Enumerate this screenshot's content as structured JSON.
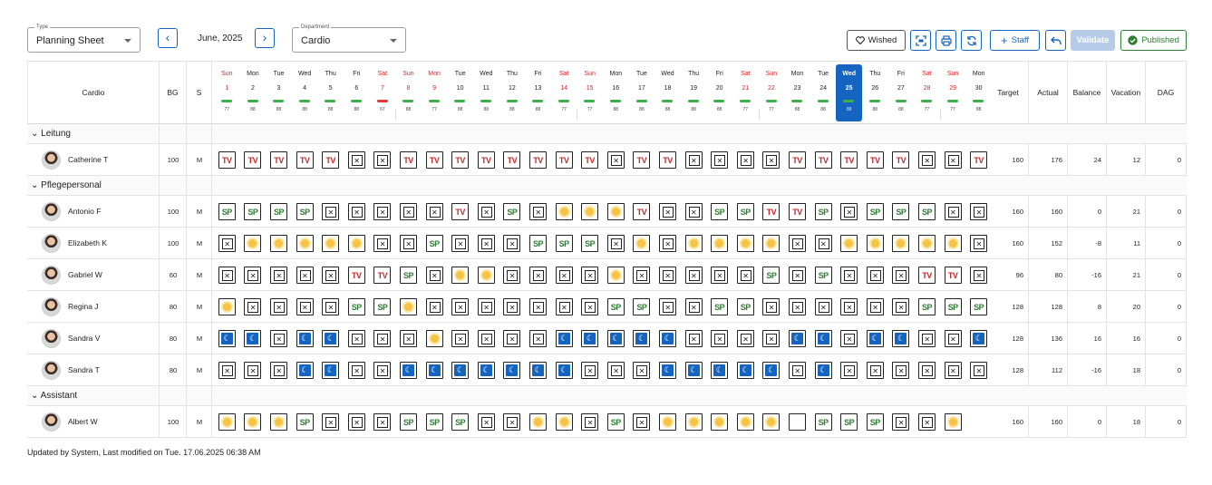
{
  "toolbar": {
    "type_label": "Type",
    "type_value": "Planning Sheet",
    "department_label": "Department",
    "department_value": "Cardio",
    "month": "June, 2025",
    "wished_label": "Wished",
    "staff_label": "Staff",
    "validate_label": "Validate",
    "published_label": "Published"
  },
  "grid": {
    "dept_header": "Cardio",
    "bg_header": "BG",
    "s_header": "S",
    "summary_headers": [
      "Target",
      "Actual",
      "Balance",
      "Vacation",
      "DAG"
    ],
    "days": [
      {
        "dn": "Sun",
        "dd": "1",
        "cnt": "77",
        "we": true,
        "red": false
      },
      {
        "dn": "Mon",
        "dd": "2",
        "cnt": "88",
        "we": false,
        "red": false
      },
      {
        "dn": "Tue",
        "dd": "3",
        "cnt": "88",
        "we": false,
        "red": false
      },
      {
        "dn": "Wed",
        "dd": "4",
        "cnt": "88",
        "we": false,
        "red": false
      },
      {
        "dn": "Thu",
        "dd": "5",
        "cnt": "88",
        "we": false,
        "red": false
      },
      {
        "dn": "Fri",
        "dd": "6",
        "cnt": "88",
        "we": false,
        "red": false
      },
      {
        "dn": "Sat",
        "dd": "7",
        "cnt": "67",
        "we": true,
        "red": true
      },
      {
        "dn": "Sun",
        "dd": "8",
        "cnt": "88",
        "we": true,
        "red": false
      },
      {
        "dn": "Mon",
        "dd": "9",
        "cnt": "77",
        "we": true,
        "red": false
      },
      {
        "dn": "Tue",
        "dd": "10",
        "cnt": "88",
        "we": false,
        "red": false
      },
      {
        "dn": "Wed",
        "dd": "11",
        "cnt": "88",
        "we": false,
        "red": false
      },
      {
        "dn": "Thu",
        "dd": "12",
        "cnt": "88",
        "we": false,
        "red": false
      },
      {
        "dn": "Fri",
        "dd": "13",
        "cnt": "88",
        "we": false,
        "red": false
      },
      {
        "dn": "Sat",
        "dd": "14",
        "cnt": "77",
        "we": true,
        "red": false
      },
      {
        "dn": "Sun",
        "dd": "15",
        "cnt": "77",
        "we": true,
        "red": false
      },
      {
        "dn": "Mon",
        "dd": "16",
        "cnt": "88",
        "we": false,
        "red": false
      },
      {
        "dn": "Tue",
        "dd": "17",
        "cnt": "88",
        "we": false,
        "red": false
      },
      {
        "dn": "Wed",
        "dd": "18",
        "cnt": "88",
        "we": false,
        "red": false
      },
      {
        "dn": "Thu",
        "dd": "19",
        "cnt": "88",
        "we": false,
        "red": false
      },
      {
        "dn": "Fri",
        "dd": "20",
        "cnt": "88",
        "we": false,
        "red": false
      },
      {
        "dn": "Sat",
        "dd": "21",
        "cnt": "77",
        "we": true,
        "red": false
      },
      {
        "dn": "Sun",
        "dd": "22",
        "cnt": "77",
        "we": true,
        "red": false
      },
      {
        "dn": "Mon",
        "dd": "23",
        "cnt": "88",
        "we": false,
        "red": false
      },
      {
        "dn": "Tue",
        "dd": "24",
        "cnt": "88",
        "we": false,
        "red": false
      },
      {
        "dn": "Wed",
        "dd": "25",
        "cnt": "88",
        "we": false,
        "red": false,
        "today": true
      },
      {
        "dn": "Thu",
        "dd": "26",
        "cnt": "88",
        "we": false,
        "red": false
      },
      {
        "dn": "Fri",
        "dd": "27",
        "cnt": "88",
        "we": false,
        "red": false
      },
      {
        "dn": "Sat",
        "dd": "28",
        "cnt": "77",
        "we": true,
        "red": false
      },
      {
        "dn": "Sun",
        "dd": "29",
        "cnt": "77",
        "we": true,
        "red": false
      },
      {
        "dn": "Mon",
        "dd": "30",
        "cnt": "88",
        "we": false,
        "red": false
      }
    ],
    "groups": [
      {
        "label": "Leitung",
        "employees": [
          {
            "name": "Catherine T",
            "bg": "100",
            "s": "M",
            "shifts": [
              "TV",
              "TV",
              "TV",
              "TV",
              "TV",
              "X",
              "X",
              "TV",
              "TV",
              "TV",
              "TV",
              "TV",
              "TV",
              "TV",
              "TV",
              "X",
              "TV",
              "TV",
              "X",
              "X",
              "X",
              "X",
              "TV",
              "TV",
              "TV",
              "TV",
              "TV",
              "X",
              "X",
              "TV"
            ],
            "target": "160",
            "actual": "176",
            "balance": "24",
            "vacation": "12",
            "dag": "0"
          }
        ]
      },
      {
        "label": "Pflegepersonal",
        "employees": [
          {
            "name": "Antonio F",
            "bg": "100",
            "s": "M",
            "shifts": [
              "SP",
              "SP",
              "SP",
              "SP",
              "X",
              "X",
              "X",
              "X",
              "X",
              "TV",
              "X",
              "SP",
              "X",
              "S",
              "S",
              "S",
              "TV",
              "X",
              "X",
              "SP",
              "SP",
              "TV",
              "TV",
              "SP",
              "X",
              "SP",
              "SP",
              "SP",
              "X",
              "X",
              "S"
            ],
            "target": "160",
            "actual": "160",
            "balance": "0",
            "vacation": "21",
            "dag": "0"
          },
          {
            "name": "Elizabeth K",
            "bg": "100",
            "s": "M",
            "shifts": [
              "X",
              "S",
              "S",
              "S",
              "S",
              "S",
              "X",
              "X",
              "SP",
              "X",
              "X",
              "X",
              "SP",
              "SP",
              "SP",
              "X",
              "S",
              "X",
              "S",
              "S",
              "S",
              "S",
              "X",
              "X",
              "S",
              "S",
              "S",
              "S",
              "S",
              "X"
            ],
            "target": "160",
            "actual": "152",
            "balance": "-8",
            "vacation": "11",
            "dag": "0"
          },
          {
            "name": "Gabriel W",
            "bg": "60",
            "s": "M",
            "shifts": [
              "X",
              "X",
              "X",
              "X",
              "X",
              "TV",
              "TV",
              "SP",
              "X",
              "S",
              "S",
              "X",
              "X",
              "X",
              "X",
              "S",
              "X",
              "X",
              "X",
              "X",
              "X",
              "SP",
              "X",
              "SP",
              "X",
              "X",
              "X",
              "TV",
              "TV",
              "X"
            ],
            "target": "96",
            "actual": "80",
            "balance": "-16",
            "vacation": "21",
            "dag": "0"
          },
          {
            "name": "Regina J",
            "bg": "80",
            "s": "M",
            "shifts": [
              "S",
              "X",
              "X",
              "X",
              "X",
              "SP",
              "SP",
              "S",
              "X",
              "X",
              "X",
              "X",
              "X",
              "X",
              "X",
              "SP",
              "SP",
              "X",
              "X",
              "SP",
              "SP",
              "X",
              "X",
              "X",
              "X",
              "X",
              "X",
              "SP",
              "SP",
              "SP"
            ],
            "target": "128",
            "actual": "128",
            "balance": "8",
            "vacation": "20",
            "dag": "0"
          },
          {
            "name": "Sandra V",
            "bg": "80",
            "s": "M",
            "shifts": [
              "M",
              "M",
              "X",
              "M",
              "M",
              "X",
              "X",
              "X",
              "S",
              "X",
              "X",
              "X",
              "X",
              "M",
              "M",
              "M",
              "M",
              "M",
              "X",
              "X",
              "X",
              "X",
              "M",
              "M",
              "X",
              "M",
              "M",
              "X",
              "X",
              "M"
            ],
            "target": "128",
            "actual": "136",
            "balance": "16",
            "vacation": "16",
            "dag": "0"
          },
          {
            "name": "Sandra T",
            "bg": "80",
            "s": "M",
            "shifts": [
              "X",
              "X",
              "X",
              "M",
              "M",
              "X",
              "X",
              "M",
              "M",
              "M",
              "M",
              "M",
              "M",
              "M",
              "X",
              "X",
              "X",
              "M",
              "M",
              "M",
              "M",
              "M",
              "X",
              "M",
              "X",
              "X",
              "X",
              "X",
              "X",
              "X"
            ],
            "target": "128",
            "actual": "112",
            "balance": "-16",
            "vacation": "18",
            "dag": "0"
          }
        ]
      },
      {
        "label": "Assistant",
        "employees": [
          {
            "name": "Albert W",
            "bg": "100",
            "s": "M",
            "shifts": [
              "S",
              "S",
              "S",
              "SP",
              "X",
              "X",
              "X",
              "SP",
              "SP",
              "SP",
              "X",
              "X",
              "S",
              "S",
              "X",
              "SP",
              "X",
              "S",
              "S",
              "S",
              "S",
              "S",
              "E",
              "SP",
              "SP",
              "SP",
              "X",
              "X",
              "S"
            ],
            "target": "160",
            "actual": "160",
            "balance": "0",
            "vacation": "18",
            "dag": "0"
          }
        ]
      }
    ]
  },
  "footer": "Updated by System, Last modified on Tue. 17.06.2025 06:38 AM",
  "colors": {
    "accent": "#1565c0",
    "weekend": "#e02424",
    "green": "#2e7d32",
    "red": "#c62828"
  }
}
